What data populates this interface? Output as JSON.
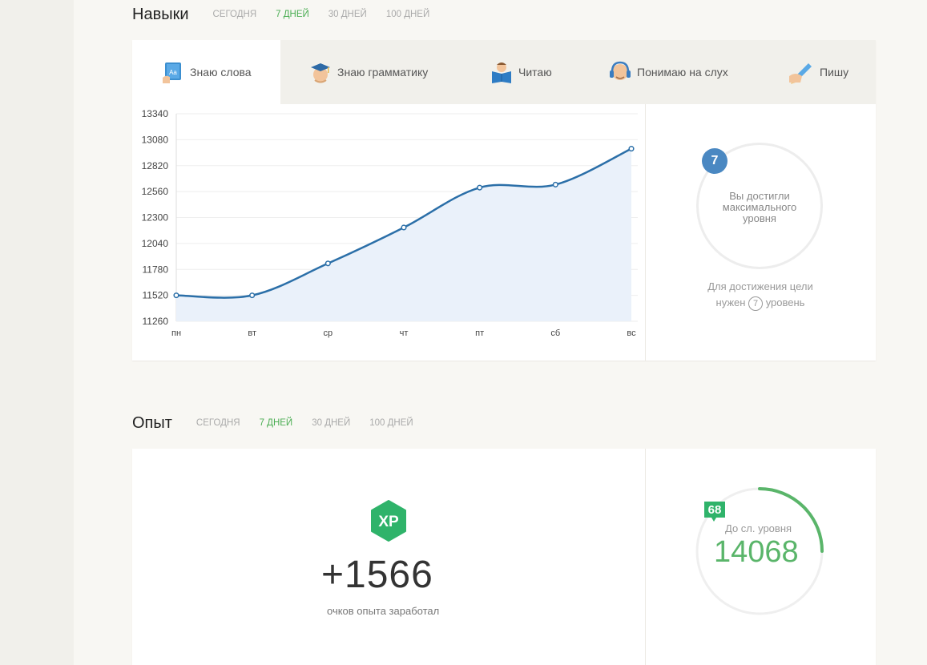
{
  "periods": [
    "СЕГОДНЯ",
    "7 ДНЕЙ",
    "30 ДНЕЙ",
    "100 ДНЕЙ"
  ],
  "skills": {
    "title": "Навыки",
    "active_period": 1,
    "tabs": [
      {
        "label": "Знаю слова",
        "icon": "book-hand-icon"
      },
      {
        "label": "Знаю грамматику",
        "icon": "graduate-icon"
      },
      {
        "label": "Читаю",
        "icon": "reader-icon"
      },
      {
        "label": "Понимаю на слух",
        "icon": "headphones-icon"
      },
      {
        "label": "Пишу",
        "icon": "pencil-hand-icon"
      }
    ],
    "active_tab": 0,
    "goal": {
      "level": "7",
      "message": "Вы достигли максимального уровня",
      "sub_before": "Для достижения цели",
      "sub_mid": "нужен",
      "sub_level": "7",
      "sub_after": "уровень"
    }
  },
  "chart_data": {
    "type": "area",
    "categories": [
      "пн",
      "вт",
      "ср",
      "чт",
      "пт",
      "сб",
      "вс"
    ],
    "values": [
      11520,
      11520,
      11840,
      12200,
      12600,
      12630,
      12990
    ],
    "yticks": [
      11260,
      11520,
      11780,
      12040,
      12300,
      12560,
      12820,
      13080,
      13340
    ],
    "ylim": [
      11260,
      13340
    ],
    "grid": true,
    "line_color": "#2b6fa8",
    "fill_color": "#eaf1fa"
  },
  "experience": {
    "title": "Опыт",
    "active_period": 1,
    "xp_badge": "XP",
    "xp_value": "+1566",
    "xp_caption": "очков опыта заработал",
    "level_badge": "68",
    "next_level_label": "До сл. уровня",
    "next_level_value": "14068",
    "level_progress": 0.25,
    "accent_color": "#5ab56a"
  }
}
